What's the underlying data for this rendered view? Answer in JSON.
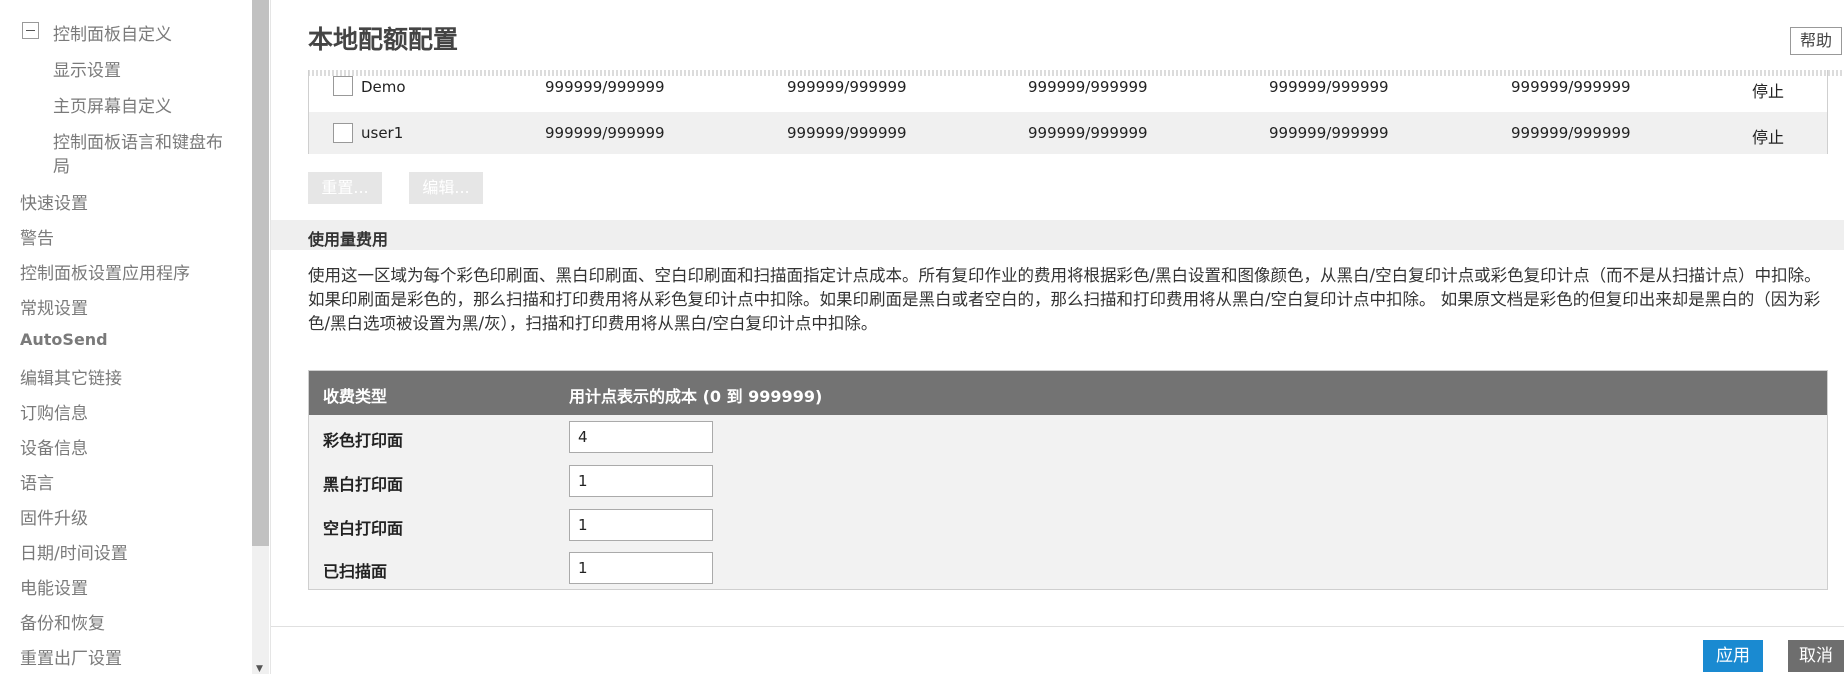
{
  "sidebar": {
    "group_title": "控制面板自定义",
    "sub_items": [
      "显示设置",
      "主页屏幕自定义",
      "控制面板语言和键盘布",
      "局"
    ],
    "items": [
      "快速设置",
      "警告",
      "控制面板设置应用程序",
      "常规设置",
      "AutoSend",
      "编辑其它链接",
      "订购信息",
      "设备信息",
      "语言",
      "固件升级",
      "日期/时间设置",
      "电能设置",
      "备份和恢复",
      "重置出厂设置"
    ]
  },
  "header": {
    "title": "本地配额配置",
    "help_label": "帮助"
  },
  "user_table": {
    "rows": [
      {
        "name": "Demo",
        "values": [
          "999999/999999",
          "999999/999999",
          "999999/999999",
          "999999/999999",
          "999999/999999"
        ],
        "status": "停止"
      },
      {
        "name": "user1",
        "values": [
          "999999/999999",
          "999999/999999",
          "999999/999999",
          "999999/999999",
          "999999/999999"
        ],
        "status": "停止"
      }
    ],
    "reset_label": "重置...",
    "edit_label": "编辑..."
  },
  "usage": {
    "section_title": "使用量费用",
    "description": "使用这一区域为每个彩色印刷面、黑白印刷面、空白印刷面和扫描面指定计点成本。所有复印作业的费用将根据彩色/黑白设置和图像颜色，从黑白/空白复印计点或彩色复印计点（而不是从扫描计点）中扣除。如果印刷面是彩色的，那么扫描和打印费用将从彩色复印计点中扣除。如果印刷面是黑白或者空白的，那么扫描和打印费用将从黑白/空白复印计点中扣除。 如果原文档是彩色的但复印出来却是黑白的（因为彩色/黑白选项被设置为黑/灰），扫描和打印费用将从黑白/空白复印计点中扣除。",
    "col_type": "收费类型",
    "col_cost": "用计点表示的成本 (0 到 999999)",
    "rows": [
      {
        "label": "彩色打印面",
        "value": "4"
      },
      {
        "label": "黑白打印面",
        "value": "1"
      },
      {
        "label": "空白打印面",
        "value": "1"
      },
      {
        "label": "已扫描面",
        "value": "1"
      }
    ]
  },
  "footer": {
    "apply_label": "应用",
    "cancel_label": "取消"
  },
  "colors": {
    "accent": "#1a8ad1",
    "header_bg": "#737373"
  }
}
